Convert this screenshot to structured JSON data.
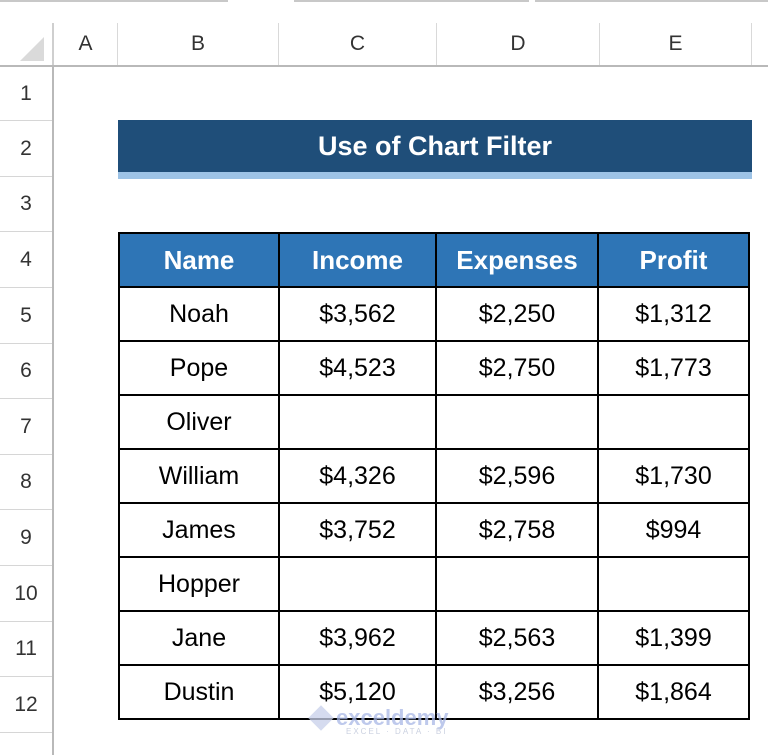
{
  "column_headers": [
    "A",
    "B",
    "C",
    "D",
    "E"
  ],
  "row_headers": [
    "1",
    "2",
    "3",
    "4",
    "5",
    "6",
    "7",
    "8",
    "9",
    "10",
    "11",
    "12"
  ],
  "title": "Use of Chart Filter",
  "table": {
    "headers": [
      "Name",
      "Income",
      "Expenses",
      "Profit"
    ],
    "rows": [
      [
        "Noah",
        "$3,562",
        "$2,250",
        "$1,312"
      ],
      [
        "Pope",
        "$4,523",
        "$2,750",
        "$1,773"
      ],
      [
        "Oliver",
        "",
        "",
        ""
      ],
      [
        "William",
        "$4,326",
        "$2,596",
        "$1,730"
      ],
      [
        "James",
        "$3,752",
        "$2,758",
        "$994"
      ],
      [
        "Hopper",
        "",
        "",
        ""
      ],
      [
        "Jane",
        "$3,962",
        "$2,563",
        "$1,399"
      ],
      [
        "Dustin",
        "$5,120",
        "$3,256",
        "$1,864"
      ]
    ]
  },
  "watermark": {
    "name": "exceldemy",
    "tagline": "EXCEL · DATA · BI"
  },
  "colors": {
    "title_bg": "#1f4e79",
    "title_underline": "#9dc3e6",
    "header_bg": "#2e75b6"
  }
}
